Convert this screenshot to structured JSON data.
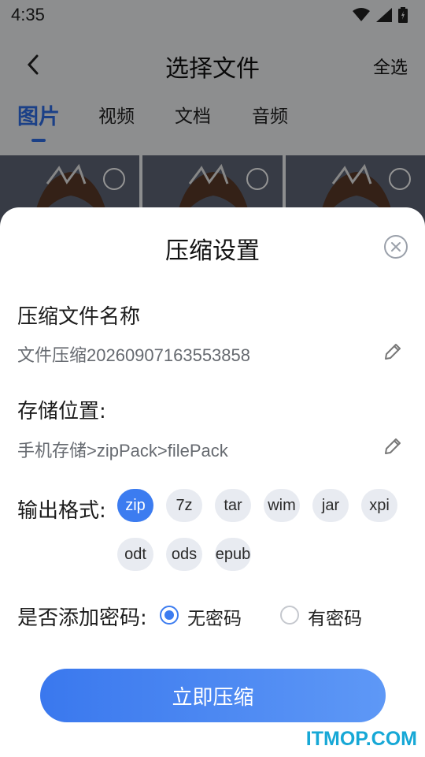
{
  "status_bar": {
    "time": "4:35"
  },
  "header": {
    "title": "选择文件",
    "select_all": "全选"
  },
  "tabs": [
    {
      "label": "图片",
      "active": true
    },
    {
      "label": "视频",
      "active": false
    },
    {
      "label": "文档",
      "active": false
    },
    {
      "label": "音频",
      "active": false
    }
  ],
  "sheet": {
    "title": "压缩设置",
    "file_name": {
      "label": "压缩文件名称",
      "value": "文件压缩20260907163553858"
    },
    "storage": {
      "label": "存储位置:",
      "value": "手机存储>zipPack>filePack"
    },
    "format": {
      "label": "输出格式:",
      "options": [
        "zip",
        "7z",
        "tar",
        "wim",
        "jar",
        "xpi",
        "odt",
        "ods",
        "epub"
      ],
      "selected": "zip"
    },
    "password": {
      "label": "是否添加密码:",
      "options": [
        "无密码",
        "有密码"
      ],
      "selected": "无密码"
    },
    "submit_label": "立即压缩"
  },
  "colors": {
    "accent": "#3c7cf0",
    "chip_bg": "#e8ebf1",
    "watermark": "#17a8d6"
  },
  "watermark": "ITMOP.COM"
}
